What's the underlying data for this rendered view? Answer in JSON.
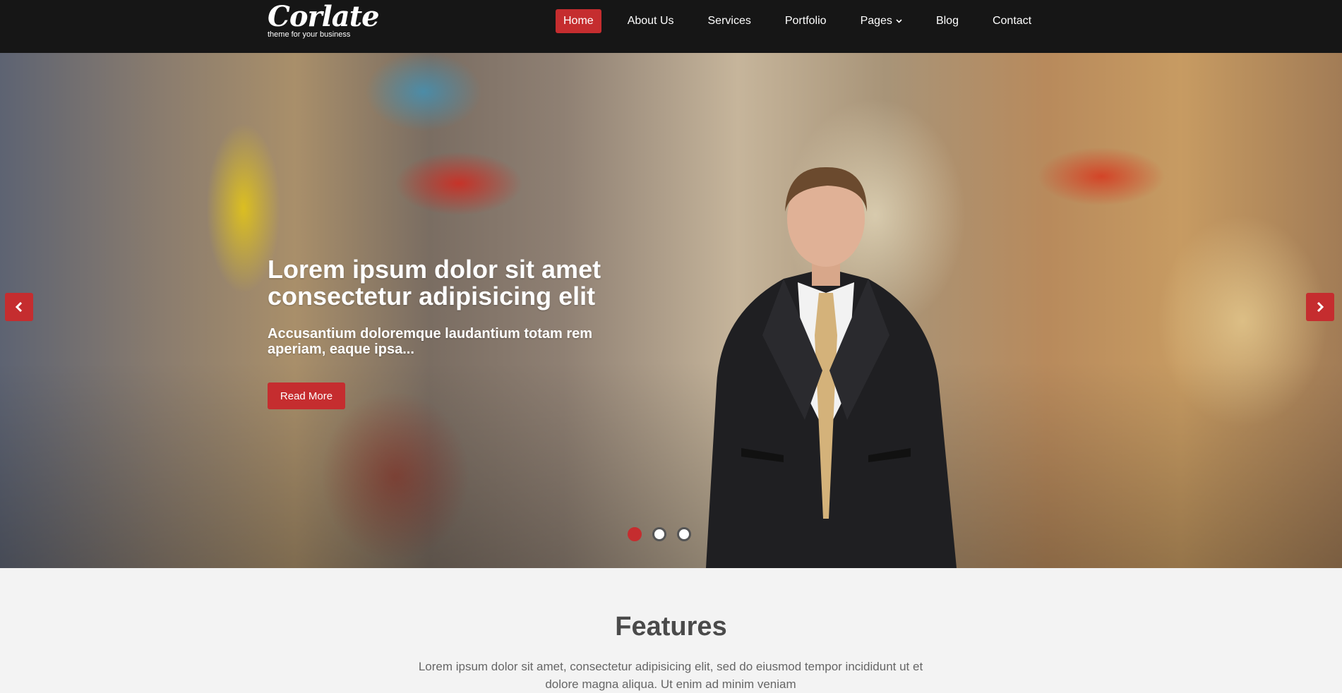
{
  "colors": {
    "accent": "#c52d2f",
    "header_bg": "#161616",
    "page_bg": "#f3f3f3"
  },
  "header": {
    "logo": {
      "name": "Corlate",
      "tagline": "theme for your business"
    },
    "nav": [
      {
        "label": "Home",
        "active": true
      },
      {
        "label": "About Us"
      },
      {
        "label": "Services"
      },
      {
        "label": "Portfolio"
      },
      {
        "label": "Pages",
        "icon": "chevron-down-icon"
      },
      {
        "label": "Blog"
      },
      {
        "label": "Contact"
      }
    ]
  },
  "hero": {
    "title": "Lorem ipsum dolor sit amet consectetur adipisicing elit",
    "subtitle": "Accusantium doloremque laudantium totam rem aperiam, eaque ipsa...",
    "button_label": "Read More",
    "prev_icon": "chevron-left-icon",
    "next_icon": "chevron-right-icon",
    "slides": {
      "count": 3,
      "active": 1
    }
  },
  "features": {
    "title": "Features",
    "text": "Lorem ipsum dolor sit amet, consectetur adipisicing elit, sed do eiusmod tempor incididunt ut et dolore magna aliqua. Ut enim ad minim veniam"
  }
}
